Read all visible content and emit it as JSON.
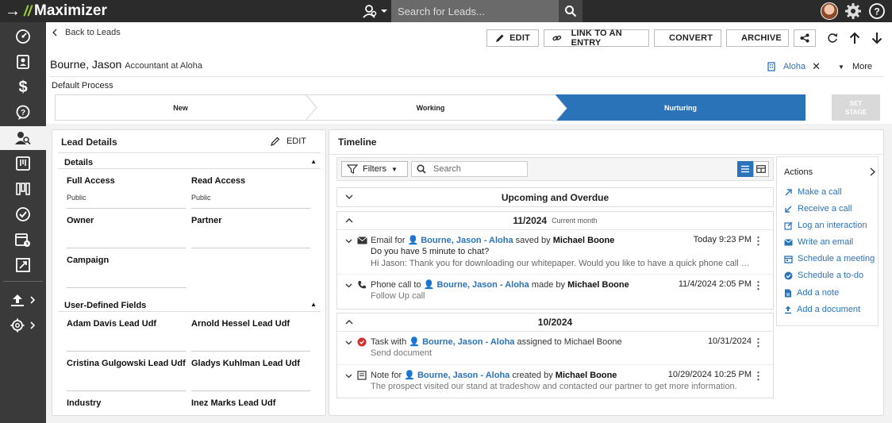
{
  "app": {
    "name": "Maximizer",
    "search_placeholder": "Search for Leads..."
  },
  "colors": {
    "accent": "#2a73b8",
    "brand_green": "#9bd43a",
    "topbar": "#2b2b2b",
    "sidebar": "#3a3a3a"
  },
  "sidebar": {
    "items": [
      {
        "icon": "dashboard-icon"
      },
      {
        "icon": "contacts-icon"
      },
      {
        "icon": "dollar-icon"
      },
      {
        "icon": "customer-service-icon"
      },
      {
        "icon": "leads-icon",
        "active": true
      },
      {
        "icon": "campaigns-icon"
      },
      {
        "icon": "pipeline-icon"
      },
      {
        "icon": "tasks-icon"
      },
      {
        "icon": "calendar-icon"
      },
      {
        "icon": "reports-icon"
      },
      {
        "icon": "import-icon"
      },
      {
        "icon": "settings-icon"
      }
    ]
  },
  "header": {
    "back_label": "Back to Leads",
    "toolbar": {
      "edit": "EDIT",
      "link": "LINK TO AN ENTRY",
      "convert": "CONVERT",
      "archive": "ARCHIVE"
    },
    "lead_name": "Bourne, Jason",
    "lead_sub": "Accountant at Aloha",
    "company_tag": "Aloha",
    "more": "More",
    "process_label": "Default Process",
    "stages": [
      "New",
      "Working",
      "Nurturing"
    ],
    "active_stage": "Nurturing",
    "set_stage_1": "SET",
    "set_stage_2": "STAGE"
  },
  "lead_details": {
    "title": "Lead Details",
    "edit": "EDIT",
    "details_title": "Details",
    "full_access_label": "Full Access",
    "full_access_value": "Public",
    "read_access_label": "Read Access",
    "read_access_value": "Public",
    "owner_label": "Owner",
    "partner_label": "Partner",
    "campaign_label": "Campaign",
    "udf_title": "User-Defined Fields",
    "udf1": "Adam Davis Lead Udf",
    "udf2": "Arnold Hessel Lead Udf",
    "udf3": "Cristina Gulgowski Lead Udf",
    "udf4": "Gladys Kuhlman Lead Udf",
    "udf5": "Industry",
    "udf6": "Inez Marks Lead Udf"
  },
  "timeline": {
    "title": "Timeline",
    "filters": "Filters",
    "search_placeholder": "Search",
    "upcoming": "Upcoming and Overdue",
    "group1": "11/2024",
    "group1_note": "Current month",
    "group2": "10/2024",
    "entries": {
      "e1": {
        "type": "Email for",
        "who": "Bourne, Jason - Aloha",
        "verb": "saved by",
        "by": "Michael Boone",
        "time": "Today 9:23 PM",
        "subject": "Do you have 5 minute to chat?",
        "preview": "Hi Jason: Thank you for downloading our whitepaper. Would you like to have a quick phone call for..."
      },
      "e2": {
        "type": "Phone call to",
        "who": "Bourne, Jason - Aloha",
        "verb": "made by",
        "by": "Michael Boone",
        "time": "11/4/2024 2:05 PM",
        "subject": "Follow Up call"
      },
      "e3": {
        "type": "Task with",
        "who": "Bourne, Jason - Aloha",
        "verb": "assigned to",
        "by": "Michael Boone",
        "time": "10/31/2024",
        "subject": "Send document"
      },
      "e4": {
        "type": "Note for",
        "who": "Bourne, Jason - Aloha",
        "verb": "created by",
        "by": "Michael Boone",
        "time": "10/29/2024 10:25 PM",
        "subject": "The prospect visited our stand at tradeshow and contacted our partner to get more information."
      }
    }
  },
  "actions": {
    "title": "Actions",
    "items": [
      {
        "label": "Make a call",
        "icon": "outgoing-call-icon"
      },
      {
        "label": "Receive a call",
        "icon": "incoming-call-icon"
      },
      {
        "label": "Log an interaction",
        "icon": "log-interaction-icon"
      },
      {
        "label": "Write an email",
        "icon": "email-icon"
      },
      {
        "label": "Schedule a meeting",
        "icon": "meeting-icon"
      },
      {
        "label": "Schedule a to-do",
        "icon": "todo-icon"
      },
      {
        "label": "Add a note",
        "icon": "note-icon"
      },
      {
        "label": "Add a document",
        "icon": "upload-document-icon"
      }
    ]
  }
}
